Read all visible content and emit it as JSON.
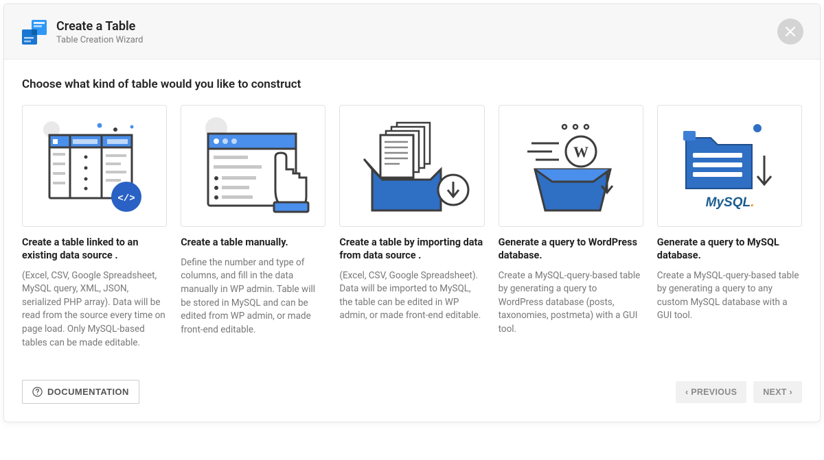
{
  "header": {
    "title": "Create a Table",
    "subtitle": "Table Creation Wizard"
  },
  "section_title": "Choose what kind of table would you like to construct",
  "cards": [
    {
      "title": "Create a table linked to an existing data source .",
      "desc": "(Excel, CSV, Google Spreadsheet, MySQL query, XML, JSON, serialized PHP array). Data will be read from the source every time on page load. Only MySQL-based tables can be made editable."
    },
    {
      "title": "Create a table manually.",
      "desc": "Define the number and type of columns, and fill in the data manually in WP admin. Table will be stored in MySQL and can be edited from WP admin, or made front-end editable."
    },
    {
      "title": "Create a table by importing data from data source .",
      "desc": "(Excel, CSV, Google Spreadsheet). Data will be imported to MySQL, the table can be edited in WP admin, or made front-end editable."
    },
    {
      "title": "Generate a query to WordPress database.",
      "desc": "Create a MySQL-query-based table by generating a query to WordPress database (posts, taxonomies, postmeta) with a GUI tool."
    },
    {
      "title": "Generate a query to MySQL database.",
      "desc": "Create a MySQL-query-based table by generating a query to any custom MySQL database with a GUI tool."
    }
  ],
  "footer": {
    "documentation": "DOCUMENTATION",
    "previous": "PREVIOUS",
    "next": "NEXT"
  },
  "mysql_label": "MySQL"
}
